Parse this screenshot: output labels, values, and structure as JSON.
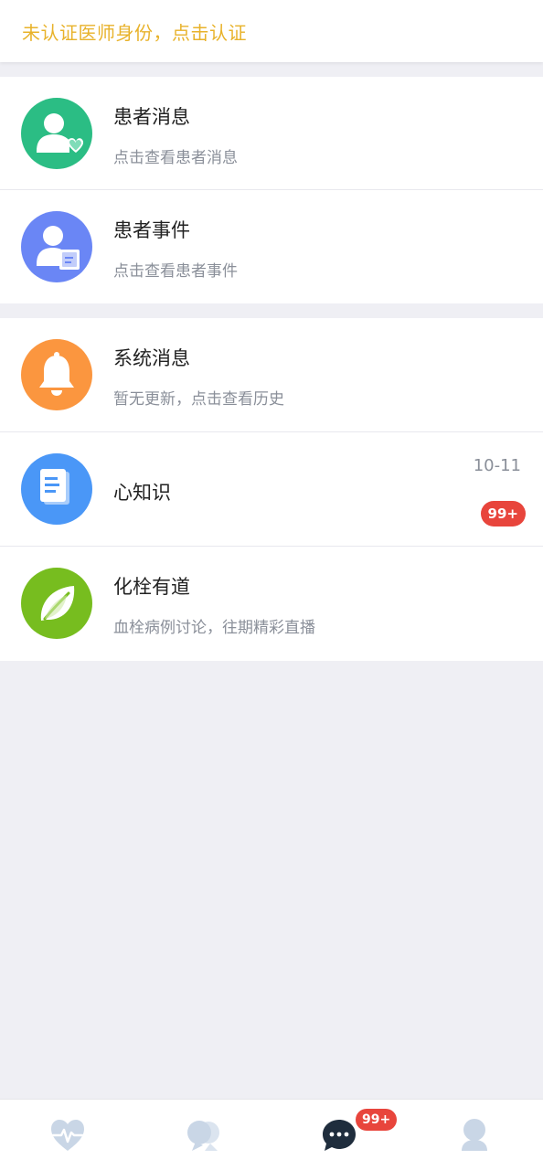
{
  "banner": {
    "text": "未认证医师身份，点击认证",
    "color": "#e8b22a"
  },
  "groups": [
    {
      "items": [
        {
          "title": "患者消息",
          "subtitle": "点击查看患者消息",
          "icon": "patient-heart-icon",
          "color": "#2bbd84"
        },
        {
          "title": "患者事件",
          "subtitle": "点击查看患者事件",
          "icon": "patient-document-icon",
          "color": "#6a86f5"
        }
      ]
    },
    {
      "items": [
        {
          "title": "系统消息",
          "subtitle": "暂无更新，点击查看历史",
          "icon": "bell-icon",
          "color": "#fb963f"
        },
        {
          "title": "心知识",
          "time": "10-11",
          "badge": "99+",
          "icon": "book-icon",
          "color": "#4a97f7"
        },
        {
          "title": "化栓有道",
          "subtitle": "血栓病例讨论，往期精彩直播",
          "icon": "leaf-icon",
          "color": "#77bd1f"
        }
      ]
    }
  ],
  "tabbar": {
    "tabs": [
      {
        "icon": "heart-pulse-icon",
        "active": false
      },
      {
        "icon": "people-icon",
        "active": false
      },
      {
        "icon": "chat-bubble-icon",
        "active": true,
        "badge": "99+"
      },
      {
        "icon": "user-icon",
        "active": false
      }
    ],
    "inactive_color": "#c9d6e6",
    "active_color": "#1f2d3d"
  }
}
